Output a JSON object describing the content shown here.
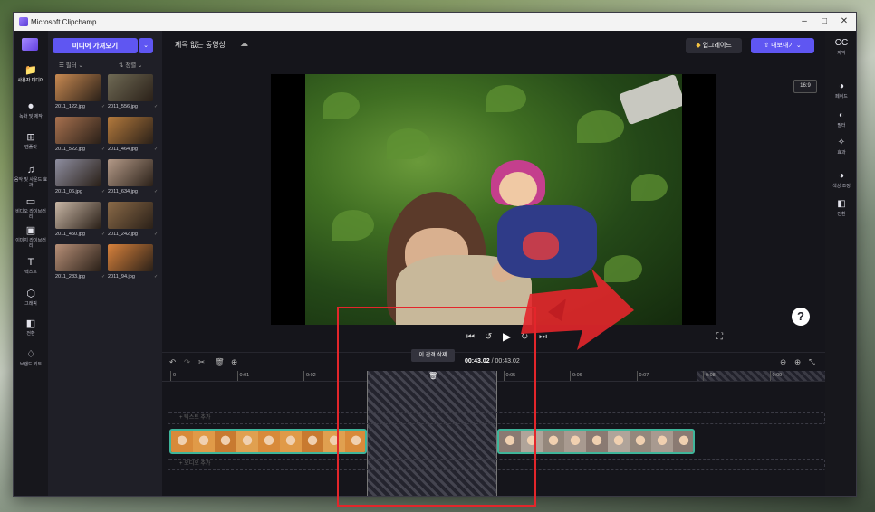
{
  "window": {
    "title": "Microsoft Clipchamp",
    "controls": [
      "–",
      "□",
      "✕"
    ]
  },
  "rail": {
    "items": [
      {
        "icon": "folder-icon",
        "glyph": "📁",
        "label": "사용자 미디어"
      },
      {
        "icon": "video-camera-icon",
        "glyph": "⏺",
        "label": "녹화 및 제작"
      },
      {
        "icon": "templates-icon",
        "glyph": "⊞",
        "label": "템플릿"
      },
      {
        "icon": "music-icon",
        "glyph": "♫",
        "label": "음악 및 사운드 효과"
      },
      {
        "icon": "stock-video-icon",
        "glyph": "▭",
        "label": "비디오 라이브러리"
      },
      {
        "icon": "image-icon",
        "glyph": "▣",
        "label": "이미지 라이브러리"
      },
      {
        "icon": "text-icon",
        "glyph": "T",
        "label": "텍스트"
      },
      {
        "icon": "graphics-icon",
        "glyph": "⬡",
        "label": "그래픽"
      },
      {
        "icon": "transitions-icon",
        "glyph": "◧",
        "label": "전환"
      },
      {
        "icon": "brand-kit-icon",
        "glyph": "♢",
        "label": "브랜드 키트"
      }
    ]
  },
  "media": {
    "import_label": "미디어 가져오기",
    "filter_label": "필터",
    "sort_label": "정렬",
    "items": [
      {
        "name": "2011_122.jpg",
        "color": "#c98a52"
      },
      {
        "name": "2011_556.jpg",
        "color": "#6f6a55"
      },
      {
        "name": "2011_522.jpg",
        "color": "#a8714f"
      },
      {
        "name": "2011_464.jpg",
        "color": "#b47a3d"
      },
      {
        "name": "2011_06.jpg",
        "color": "#8e8ea0"
      },
      {
        "name": "2011_634.jpg",
        "color": "#b49a88"
      },
      {
        "name": "2011_450.jpg",
        "color": "#c9b7a6"
      },
      {
        "name": "2011_242.jpg",
        "color": "#8a6a48"
      },
      {
        "name": "2011_283.jpg",
        "color": "#b89078"
      },
      {
        "name": "2011_94.jpg",
        "color": "#d9823c"
      }
    ]
  },
  "header": {
    "project_title": "제목 없는 동영상",
    "upgrade_label": "업그레이드",
    "export_label": "내보내기",
    "aspect_ratio": "16:9"
  },
  "timeline": {
    "tooltip": "이 간격 삭제",
    "time_current": "00:43.02",
    "time_total": "/ 00:43.02",
    "ticks": [
      "0",
      "0:01",
      "0:02",
      "0:03",
      "0:04",
      "0:05",
      "0:06",
      "0:07",
      "0:08",
      "0:09"
    ],
    "text_track_label": "+ 텍스트 추가",
    "audio_track_label": "+ 오디오 추가"
  },
  "right_panel": {
    "items": [
      {
        "icon": "captions-icon",
        "glyph": "CC",
        "label": "자막"
      },
      {
        "icon": "fade-icon",
        "glyph": "◑",
        "label": "페이드"
      },
      {
        "icon": "filter-icon",
        "glyph": "◐",
        "label": "필터"
      },
      {
        "icon": "effects-icon",
        "glyph": "✧",
        "label": "효과"
      },
      {
        "icon": "color-adjust-icon",
        "glyph": "◑",
        "label": "색상 조정"
      },
      {
        "icon": "transition-icon",
        "glyph": "◧",
        "label": "전환"
      }
    ]
  },
  "help_label": "?",
  "colors": {
    "accent": "#5f56f2",
    "clip_border": "#3fb59a",
    "annotation": "#e3262b"
  }
}
